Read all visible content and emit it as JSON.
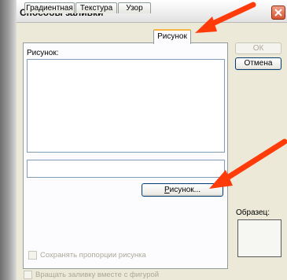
{
  "window": {
    "title": "Способы заливки"
  },
  "tabs": [
    {
      "label": "Градиентная",
      "active": false
    },
    {
      "label": "Текстура",
      "active": false
    },
    {
      "label": "Узор",
      "active": false
    },
    {
      "label": "Рисунок",
      "active": true
    }
  ],
  "panel": {
    "picture_label": "Рисунок:",
    "picture_button_label": "Рисунок...",
    "picture_button_mnemonic": "Р",
    "picture_button_rest": "исунок...",
    "name_field_value": "",
    "keep_ratio_label": "Сохранять пропорции рисунка",
    "keep_ratio_checked": false
  },
  "side": {
    "ok_label": "ОК",
    "cancel_label": "Отмена",
    "sample_label": "Образец:"
  },
  "footer": {
    "rotate_label": "Вращать заливку вместе с фигурой",
    "rotate_checked": false
  },
  "colors": {
    "annotation_arrow": "#ff3b0a",
    "active_tab_accent": "#f7b53f",
    "close_button": "#d6532e"
  },
  "icons": {
    "close": "close-icon",
    "annotation": "red-arrow"
  }
}
